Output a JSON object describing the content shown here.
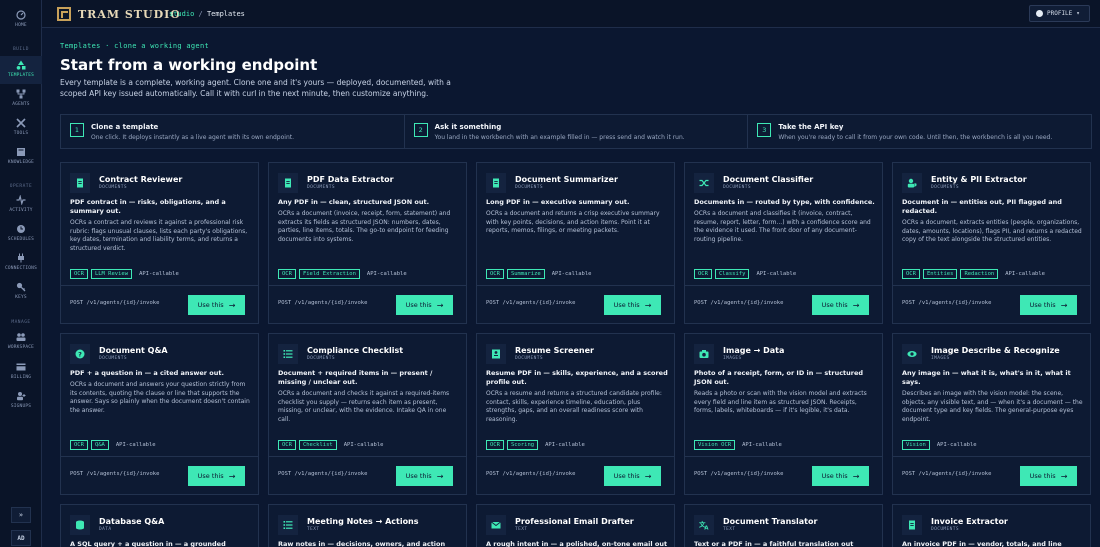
{
  "app": {
    "logo_text": "TRAM STUDIO"
  },
  "breadcrumb": {
    "root": "studio",
    "sep": " / ",
    "current": "Templates"
  },
  "profile": {
    "label": "PROFILE"
  },
  "sidebar": {
    "home": "HOME",
    "section_build": "BUILD",
    "templates": "TEMPLATES",
    "agents": "AGENTS",
    "tools": "TOOLS",
    "knowledge": "KNOWLEDGE",
    "section_operate": "OPERATE",
    "activity": "ACTIVITY",
    "schedules": "SCHEDULES",
    "connections": "CONNECTIONS",
    "keys": "KEYS",
    "section_manage": "MANAGE",
    "workspace": "WORKSPACE",
    "billing": "BILLING",
    "signups": "SIGNUPS",
    "collapse_glyph": "»",
    "avatar": "AD"
  },
  "header": {
    "eyebrow": "Templates · clone a working agent",
    "title": "Start from a working endpoint",
    "description": "Every template is a complete, working agent. Clone one and it's yours — deployed, documented, with a scoped API key issued automatically. Call it with curl in the next minute, then customize anything."
  },
  "steps": [
    {
      "num": "1",
      "title": "Clone a template",
      "sub": "One click. It deploys instantly as a live agent with its own endpoint."
    },
    {
      "num": "2",
      "title": "Ask it something",
      "sub": "You land in the workbench with an example filled in — press send and watch it run."
    },
    {
      "num": "3",
      "title": "Take the API key",
      "sub": "When you're ready to call it from your own code. Until then, the workbench is all you need."
    }
  ],
  "common": {
    "endpoint": "POST /v1/agents/{id}/invoke",
    "use_label": "Use this",
    "use_arrow": "→",
    "api_tag": "API-callable"
  },
  "cards": [
    {
      "title": "Contract Reviewer",
      "cat": "DOCUMENTS",
      "icon": "document-icon",
      "lead": "PDF contract in — risks, obligations, and a summary out.",
      "body": "OCRs a contract and reviews it against a professional risk rubric: flags unusual clauses, lists each party's obligations, key dates, termination and liability terms, and returns a structured verdict.",
      "tags": [
        "OCR",
        "LLM Review"
      ]
    },
    {
      "title": "PDF Data Extractor",
      "cat": "DOCUMENTS",
      "icon": "document-icon",
      "lead": "Any PDF in — clean, structured JSON out.",
      "body": "OCRs a document (invoice, receipt, form, statement) and extracts its fields as structured JSON: numbers, dates, parties, line items, totals. The go-to endpoint for feeding documents into systems.",
      "tags": [
        "OCR",
        "Field Extraction"
      ]
    },
    {
      "title": "Document Summarizer",
      "cat": "DOCUMENTS",
      "icon": "document-icon",
      "lead": "Long PDF in — executive summary out.",
      "body": "OCRs a document and returns a crisp executive summary with key points, decisions, and action items. Point it at reports, memos, filings, or meeting packets.",
      "tags": [
        "OCR",
        "Summarize"
      ]
    },
    {
      "title": "Document Classifier",
      "cat": "DOCUMENTS",
      "icon": "shuffle-icon",
      "lead": "Documents in — routed by type, with confidence.",
      "body": "OCRs a document and classifies it (invoice, contract, resume, report, letter, form...) with a confidence score and the evidence it used. The front door of any document-routing pipeline.",
      "tags": [
        "OCR",
        "Classify"
      ]
    },
    {
      "title": "Entity & PII Extractor",
      "cat": "DOCUMENTS",
      "icon": "user-shield-icon",
      "lead": "Document in — entities out, PII flagged and redacted.",
      "body": "OCRs a document, extracts entities (people, organizations, dates, amounts, locations), flags PII, and returns a redacted copy of the text alongside the structured entities.",
      "tags": [
        "OCR",
        "Entities",
        "Redaction"
      ]
    },
    {
      "title": "Document Q&A",
      "cat": "DOCUMENTS",
      "icon": "question-icon",
      "lead": "PDF + a question in — a cited answer out.",
      "body": "OCRs a document and answers your question strictly from its contents, quoting the clause or line that supports the answer. Says so plainly when the document doesn't contain the answer.",
      "tags": [
        "OCR",
        "Q&A"
      ]
    },
    {
      "title": "Compliance Checklist",
      "cat": "DOCUMENTS",
      "icon": "list-icon",
      "lead": "Document + required items in — present / missing / unclear out.",
      "body": "OCRs a document and checks it against a required-items checklist you supply — returns each item as present, missing, or unclear, with the evidence. Intake QA in one call.",
      "tags": [
        "OCR",
        "Checklist"
      ]
    },
    {
      "title": "Resume Screener",
      "cat": "DOCUMENTS",
      "icon": "id-card-icon",
      "lead": "Resume PDF in — skills, experience, and a scored profile out.",
      "body": "OCRs a resume and returns a structured candidate profile: contact, skills, experience timeline, education, plus strengths, gaps, and an overall readiness score with reasoning.",
      "tags": [
        "OCR",
        "Scoring"
      ]
    },
    {
      "title": "Image → Data",
      "cat": "IMAGES",
      "icon": "camera-icon",
      "lead": "Photo of a receipt, form, or ID in — structured JSON out.",
      "body": "Reads a photo or scan with the vision model and extracts every field and line item as structured JSON. Receipts, forms, labels, whiteboards — if it's legible, it's data.",
      "tags": [
        "Vision OCR"
      ]
    },
    {
      "title": "Image Describe & Recognize",
      "cat": "IMAGES",
      "icon": "eye-icon",
      "lead": "Any image in — what it is, what's in it, what it says.",
      "body": "Describes an image with the vision model: the scene, objects, any visible text, and — when it's a document — the document type and key fields. The general-purpose eyes endpoint.",
      "tags": [
        "Vision"
      ]
    },
    {
      "title": "Database Q&A",
      "cat": "DATA",
      "icon": "database-icon",
      "lead": "A SQL query + a question in — a grounded answer",
      "body": "",
      "tags": []
    },
    {
      "title": "Meeting Notes → Actions",
      "cat": "TEXT",
      "icon": "list-icon",
      "lead": "Raw notes in — decisions, owners, and action items",
      "body": "",
      "tags": []
    },
    {
      "title": "Professional Email Drafter",
      "cat": "TEXT",
      "icon": "mail-icon",
      "lead": "A rough intent in — a polished, on-tone email out",
      "body": "",
      "tags": []
    },
    {
      "title": "Document Translator",
      "cat": "TEXT",
      "icon": "translate-icon",
      "lead": "Text or a PDF in — a faithful translation out",
      "body": "",
      "tags": []
    },
    {
      "title": "Invoice Extractor",
      "cat": "DOCUMENTS",
      "icon": "document-icon",
      "lead": "An invoice PDF in — vendor, totals, and line items out",
      "body": "",
      "tags": []
    }
  ]
}
